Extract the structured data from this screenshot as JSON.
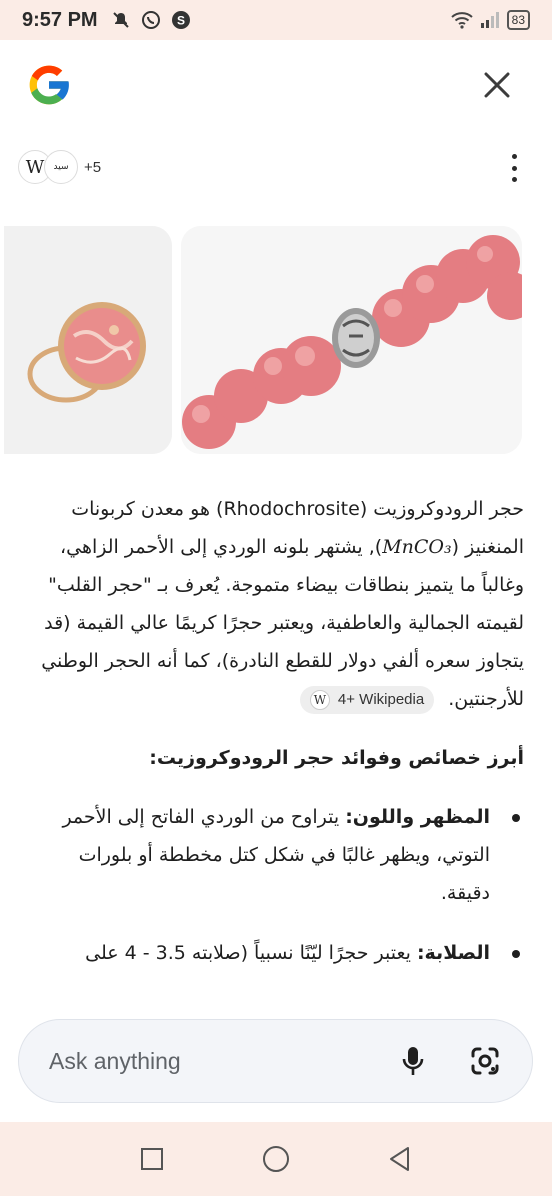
{
  "status_bar": {
    "time": "9:57 PM",
    "battery": "83",
    "icons": [
      "mute-icon",
      "whatsapp-icon",
      "app-s-icon",
      "wifi-icon",
      "signal-icon",
      "battery-icon"
    ]
  },
  "header": {
    "logo": "google-logo",
    "close_icon": "close-icon"
  },
  "sources": {
    "chips": [
      "W",
      "سيد"
    ],
    "more_label": "+5"
  },
  "images": [
    {
      "alt_icon": "ring-image"
    },
    {
      "alt_icon": "bead-necklace-image"
    }
  ],
  "answer": {
    "para_part1": "حجر الرودوكروزيت (Rhodochrosite) هو معدن كربونات المنغنيز (",
    "formula": "MnCO₃",
    "para_part2": "), يشتهر بلونه الوردي إلى الأحمر الزاهي، وغالباً ما يتميز بنطاقات بيضاء متموجة. يُعرف بـ \"حجر القلب\" لقيمته الجمالية والعاطفية، ويعتبر حجرًا كريمًا عالي القيمة (قد يتجاوز سعره ألفي دولار للقطع النادرة)، كما أنه الحجر الوطني للأرجنتين.",
    "citation": "4+ Wikipedia",
    "heading": "أبرز خصائص وفوائد حجر الرودوكروزيت:",
    "bullets": [
      {
        "title": "المظهر واللون:",
        "text": " يتراوح من الوردي الفاتح إلى الأحمر التوتي، ويظهر غالبًا في شكل كتل مخططة أو بلورات دقيقة."
      },
      {
        "title": "الصلابة:",
        "text": " يعتبر حجرًا ليّنًا نسبياً (صلابته 3.5 - 4 على"
      }
    ]
  },
  "ask_bar": {
    "placeholder": "Ask anything"
  },
  "colors": {
    "status_bg": "#fbece6",
    "ask_bg": "#f3f5f9",
    "stone_pink": "#e8838a"
  }
}
